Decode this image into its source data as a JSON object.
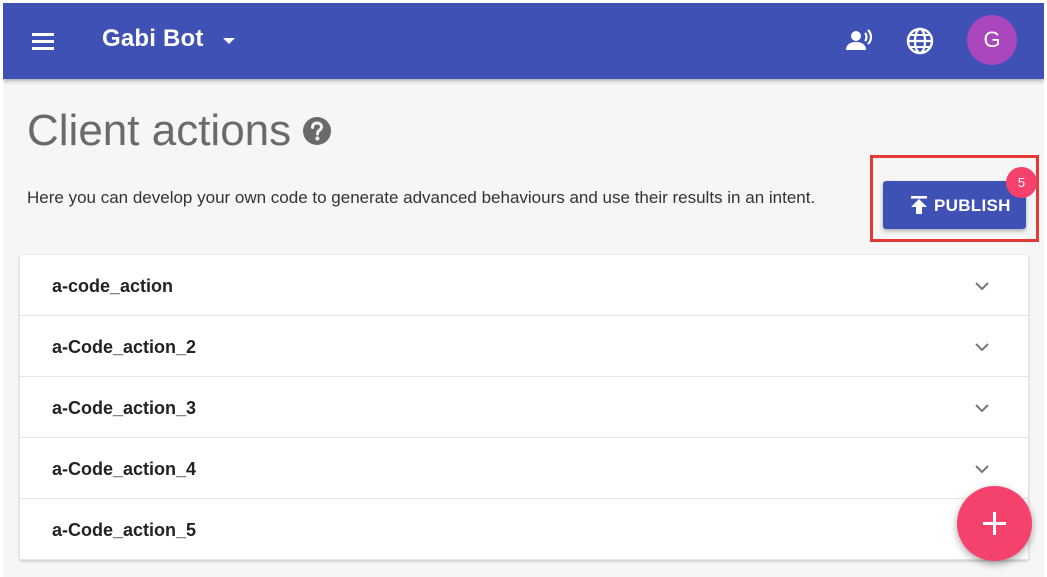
{
  "header": {
    "bot_name": "Gabi Bot",
    "menu_icon": "hamburger-menu-icon",
    "dropdown_icon": "caret-down-icon",
    "voice_icon": "voice-icon",
    "language_icon": "globe-icon",
    "avatar_letter": "G"
  },
  "page": {
    "title": "Client actions",
    "help_icon": "help-circle-icon",
    "description": "Here you can develop your own code to generate advanced behaviours and use their results in an intent."
  },
  "publish": {
    "label": "PUBLISH",
    "icon": "publish-upload-icon",
    "badge_count": "5"
  },
  "actions": [
    {
      "label": "a-code_action"
    },
    {
      "label": "a-Code_action_2"
    },
    {
      "label": "a-Code_action_3"
    },
    {
      "label": "a-Code_action_4"
    },
    {
      "label": "a-Code_action_5"
    }
  ],
  "fab": {
    "icon": "add-icon"
  },
  "colors": {
    "primary": "#3f51b5",
    "accent": "#f5426c",
    "avatar": "#ab47bc",
    "highlight": "#e53935"
  }
}
